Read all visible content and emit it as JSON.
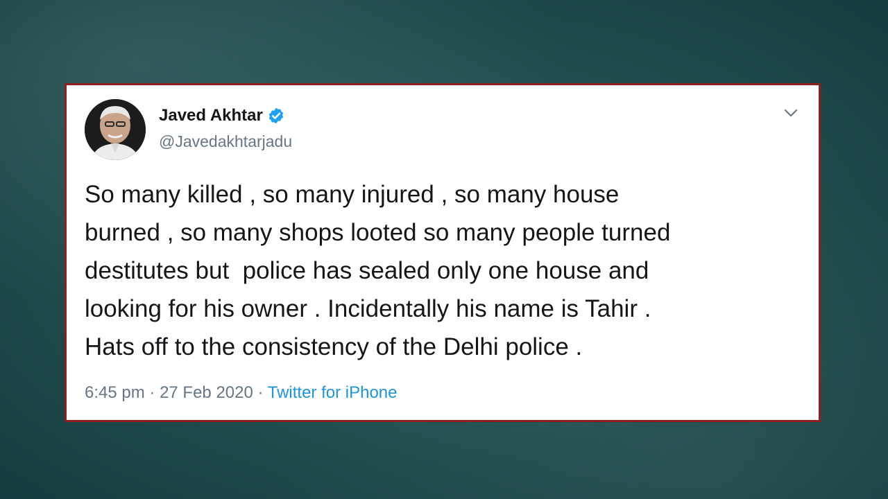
{
  "tweet": {
    "author_name": "Javed Akhtar",
    "author_handle": "@Javedakhtarjadu",
    "verified": true,
    "body_lines": [
      "So many killed , so many injured , so many house",
      "burned , so many shops looted so many people turned",
      "destitutes but  police has sealed only one house and",
      "looking for his owner . Incidentally his name is Tahir .",
      "Hats off to the consistency of the Delhi police ."
    ],
    "time": "6:45 pm",
    "date": "27 Feb 2020",
    "separator": "·",
    "source": "Twitter for iPhone"
  },
  "icons": {
    "verified": "verified-badge-icon",
    "more": "chevron-down-icon",
    "avatar": "profile-photo"
  },
  "colors": {
    "background": "#225050",
    "card": "#ffffff",
    "card_border": "#8f1f1f",
    "text": "#14171a",
    "muted": "#657786",
    "link": "#1b95e0",
    "verified": "#1da1f2"
  }
}
